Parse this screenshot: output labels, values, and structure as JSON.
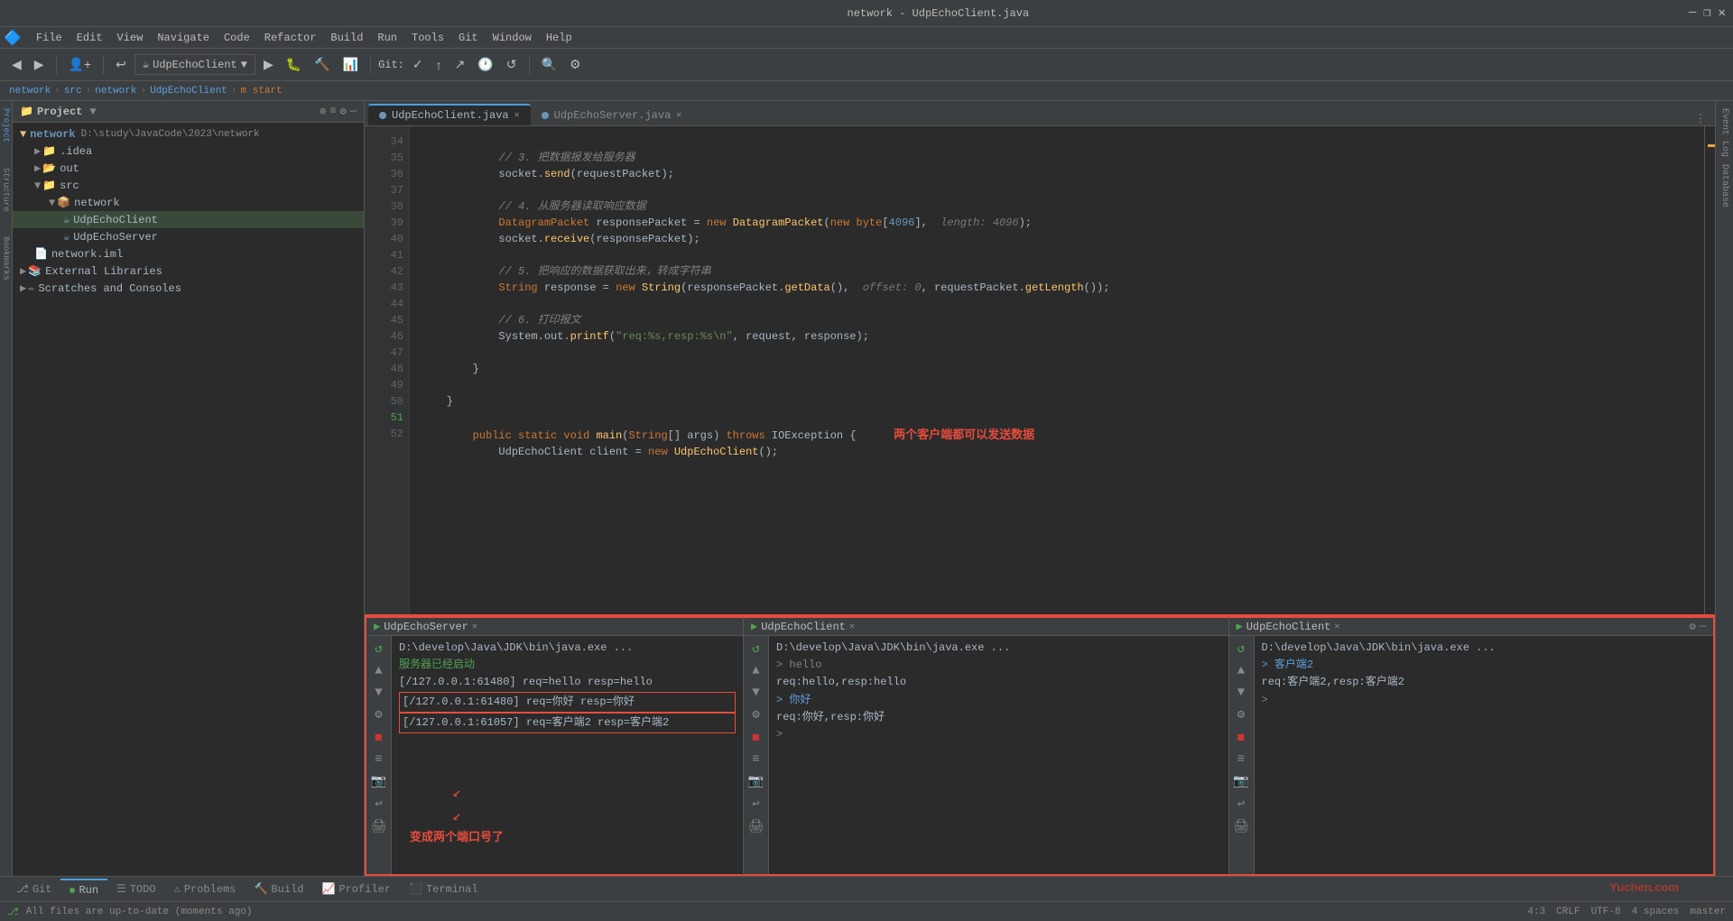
{
  "titleBar": {
    "title": "network - UdpEchoClient.java",
    "minimize": "—",
    "maximize": "❐",
    "close": "✕"
  },
  "menuBar": {
    "items": [
      "File",
      "Edit",
      "View",
      "Navigate",
      "Code",
      "Refactor",
      "Build",
      "Run",
      "Tools",
      "Git",
      "Window",
      "Help"
    ]
  },
  "toolbar": {
    "runConfig": "UdpEchoClient",
    "gitLabel": "Git:"
  },
  "breadcrumb": {
    "parts": [
      "network",
      "src",
      "network",
      "UdpEchoClient",
      "start"
    ]
  },
  "projectPanel": {
    "title": "Project",
    "root": {
      "name": "network",
      "path": "D:\\study\\JavaCode\\2023\\network",
      "children": [
        {
          "type": "folder",
          "name": ".idea",
          "indent": 1
        },
        {
          "type": "folder",
          "name": "out",
          "indent": 1
        },
        {
          "type": "folder",
          "name": "src",
          "indent": 1,
          "expanded": true,
          "children": [
            {
              "type": "folder",
              "name": "network",
              "indent": 2,
              "expanded": true,
              "children": [
                {
                  "type": "java",
                  "name": "UdpEchoClient",
                  "indent": 3
                },
                {
                  "type": "java",
                  "name": "UdpEchoServer",
                  "indent": 3
                }
              ]
            }
          ]
        },
        {
          "type": "iml",
          "name": "network.iml",
          "indent": 1
        }
      ]
    },
    "externalLibraries": "External Libraries",
    "scratchesAndConsoles": "Scratches and Consoles"
  },
  "editorTabs": [
    {
      "name": "UdpEchoClient.java",
      "active": true
    },
    {
      "name": "UdpEchoServer.java",
      "active": false
    }
  ],
  "codeLines": [
    {
      "num": 34,
      "content": "        // 3. 把数据报发给服务器"
    },
    {
      "num": 35,
      "content": "        socket.send(requestPacket);"
    },
    {
      "num": 36,
      "content": ""
    },
    {
      "num": 37,
      "content": "        // 4. 从服务器读取响应数据"
    },
    {
      "num": 38,
      "content": "        DatagramPacket responsePacket = new DatagramPacket(new byte[4096],  length: 4096);"
    },
    {
      "num": 39,
      "content": "        socket.receive(responsePacket);"
    },
    {
      "num": 40,
      "content": ""
    },
    {
      "num": 41,
      "content": ""
    },
    {
      "num": 42,
      "content": "        // 5. 把响应的数据获取出来，转成字符串"
    },
    {
      "num": 43,
      "content": "        String response = new String(responsePacket.getData(),  offset: 0, requestPacket.getLength());"
    },
    {
      "num": 44,
      "content": ""
    },
    {
      "num": 45,
      "content": "        // 6. 打印报文"
    },
    {
      "num": 46,
      "content": "        System.out.printf(\"req:%s,resp:%s\\n\", request, response);"
    },
    {
      "num": 47,
      "content": ""
    },
    {
      "num": 48,
      "content": "    }"
    },
    {
      "num": 49,
      "content": ""
    },
    {
      "num": 50,
      "content": "    }"
    },
    {
      "num": 51,
      "content": "    public static void main(String[] args) throws IOException {",
      "hasRunIcon": true
    },
    {
      "num": 52,
      "content": "        UdpEchoClient client = new UdpEchoClient();"
    }
  ],
  "annotations": {
    "twoClients": "两个客户端都可以发送数据",
    "twoPorts": "变成两个端口号了"
  },
  "runPanels": {
    "server": {
      "title": "UdpEchoServer",
      "lines": [
        "D:\\develop\\Java\\JDK\\bin\\java.exe ...",
        "服务器已经启动",
        "[/127.0.0.1:61480] req=hello resp=hello",
        "[/127.0.0.1:61480] req=你好 resp=你好",
        "[/127.0.0.1:61057] req=客户端2 resp=客户端2"
      ]
    },
    "client1": {
      "title": "UdpEchoClient",
      "lines": [
        "D:\\develop\\Java\\JDK\\bin\\java.exe ...",
        "> hello",
        "req:hello,resp:hello",
        "> 你好",
        "req:你好,resp:你好",
        ">"
      ]
    },
    "client2": {
      "title": "UdpEchoClient",
      "lines": [
        "D:\\develop\\Java\\JDK\\bin\\java.exe ...",
        "> 客户端2",
        "req:客户端2,resp:客户端2",
        ">"
      ]
    }
  },
  "bottomTabs": {
    "items": [
      "Git",
      "Run",
      "TODO",
      "Problems",
      "Build",
      "Profiler",
      "Terminal"
    ]
  },
  "statusBar": {
    "message": "All files are up-to-date (moments ago)",
    "position": "4:3",
    "lineEnding": "CRLF",
    "encoding": "UTF-8",
    "indent": "4 spaces",
    "branch": "master"
  },
  "rightSidebarItems": [
    "Event Log",
    "Database"
  ],
  "watermark": "Yuchen.com"
}
